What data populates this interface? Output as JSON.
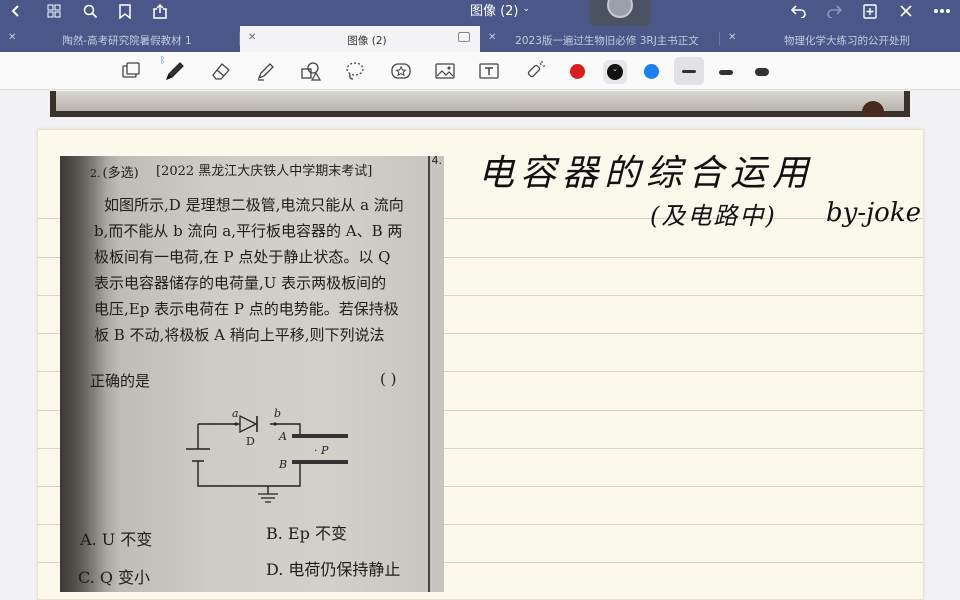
{
  "window": {
    "title": "图像 (2)",
    "icons": {
      "back": "chevron-left-icon",
      "grid": "grid-icon",
      "search": "search-icon",
      "bookmark": "bookmark-icon",
      "share": "share-icon",
      "undo": "undo-icon",
      "redo": "redo-icon",
      "add": "add-page-icon",
      "close": "close-icon",
      "more": "more-icon"
    }
  },
  "tabs": [
    {
      "label": "陶然-高考研究院暑假教材 1",
      "active": false
    },
    {
      "label": "图像 (2)",
      "active": true
    },
    {
      "label": "2023版一遍过生物旧必修 3RJ主书正文",
      "active": false
    },
    {
      "label": "物理化学大练习的公开处刑",
      "active": false
    }
  ],
  "toolbar": {
    "tools": [
      "page-layout-icon",
      "pen-icon",
      "eraser-icon",
      "highlighter-icon",
      "shapes-icon",
      "lasso-icon",
      "sticker-icon",
      "image-icon",
      "text-icon",
      "laser-pointer-icon"
    ],
    "bluetooth": "ᛒ",
    "colors": {
      "red": "#d81e1e",
      "black": "#111111",
      "blue": "#1b7ff0"
    },
    "selected_color_mark": "⌄"
  },
  "question": {
    "number": "2.",
    "type": "(多选)",
    "source": "[2022 黑龙江大庆铁人中学期末考试]",
    "lines": [
      "如图所示,D 是理想二极管,电流只能从 a 流向",
      "b,而不能从 b 流向 a,平行板电容器的 A、B 两",
      "极板间有一电荷,在 P 点处于静止状态。以 Q",
      "表示电容器储存的电荷量,U 表示两极板间的",
      "电压,Ep 表示电荷在 P 点的电势能。若保持极",
      "板 B 不动,将极板 A 稍向上平移,则下列说法",
      "正确的是"
    ],
    "answer_paren": "(     )",
    "next_number": "4.",
    "circuit_labels": {
      "a": "a",
      "b": "b",
      "D": "D",
      "A": "A",
      "B": "B",
      "P": "· P"
    },
    "options": {
      "A": "A. U 不变",
      "B": "B. Ep 不变",
      "C": "C. Q 变小",
      "D": "D. 电荷仍保持静止"
    }
  },
  "handwriting": {
    "title": "电容器的综合运用",
    "subtitle": "(及电路中)",
    "author": "by-joker"
  }
}
